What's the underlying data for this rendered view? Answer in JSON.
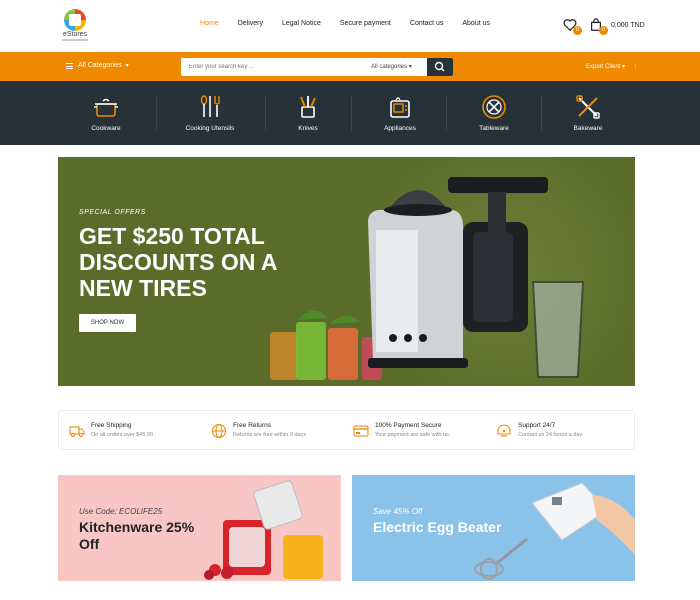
{
  "brand": {
    "name": "eStores"
  },
  "nav": [
    {
      "label": "Home",
      "active": true
    },
    {
      "label": "Delivery",
      "active": false
    },
    {
      "label": "Legal Notice",
      "active": false
    },
    {
      "label": "Secure payment",
      "active": false
    },
    {
      "label": "Contact us",
      "active": false
    },
    {
      "label": "About us",
      "active": false
    }
  ],
  "header_icons": {
    "wishlist_icon": "heart-icon",
    "wishlist_count": "0",
    "cart_icon": "bag-icon",
    "cart_count": "0",
    "cart_total": "0,000 TND"
  },
  "toolbar": {
    "all_categories_label": "All Categories",
    "search_placeholder": "Enter your search key ...",
    "search_category": "All categories",
    "right_option": "Export Client"
  },
  "categories": [
    {
      "label": "Cookware",
      "icon": "pot-icon"
    },
    {
      "label": "Cooking Utensils",
      "icon": "utensils-icon"
    },
    {
      "label": "Knives",
      "icon": "knives-icon"
    },
    {
      "label": "Appliances",
      "icon": "appliance-icon"
    },
    {
      "label": "Tableware",
      "icon": "tableware-icon"
    },
    {
      "label": "Bakeware",
      "icon": "bakeware-icon"
    }
  ],
  "hero": {
    "kicker": "SPECIAL OFFERS",
    "title": "GET $250 TOTAL DISCOUNTS ON A NEW TIRES",
    "button": "SHOP NOW"
  },
  "features": [
    {
      "title": "Free Shipping",
      "subtitle": "On all orders over $45.00",
      "icon": "truck-icon"
    },
    {
      "title": "Free Returns",
      "subtitle": "Returns are free within 9 days",
      "icon": "globe-icon"
    },
    {
      "title": "100% Payment Secure",
      "subtitle": "Your payment are safe with us.",
      "icon": "payment-icon"
    },
    {
      "title": "Support 24/7",
      "subtitle": "Contact us 24 hours a day",
      "icon": "support-icon"
    }
  ],
  "promos": [
    {
      "kicker": "Use Code: ECOLIFE25",
      "title": "Kitchenware 25% Off"
    },
    {
      "kicker": "Save 45% Off",
      "title": "Electric Egg Beater"
    }
  ],
  "colors": {
    "accent": "#ef8a00",
    "dark": "#263238",
    "hero_bg": "#5a6b2a",
    "pink_bg": "#f9c6c6",
    "blue_bg": "#8bc2ea"
  }
}
